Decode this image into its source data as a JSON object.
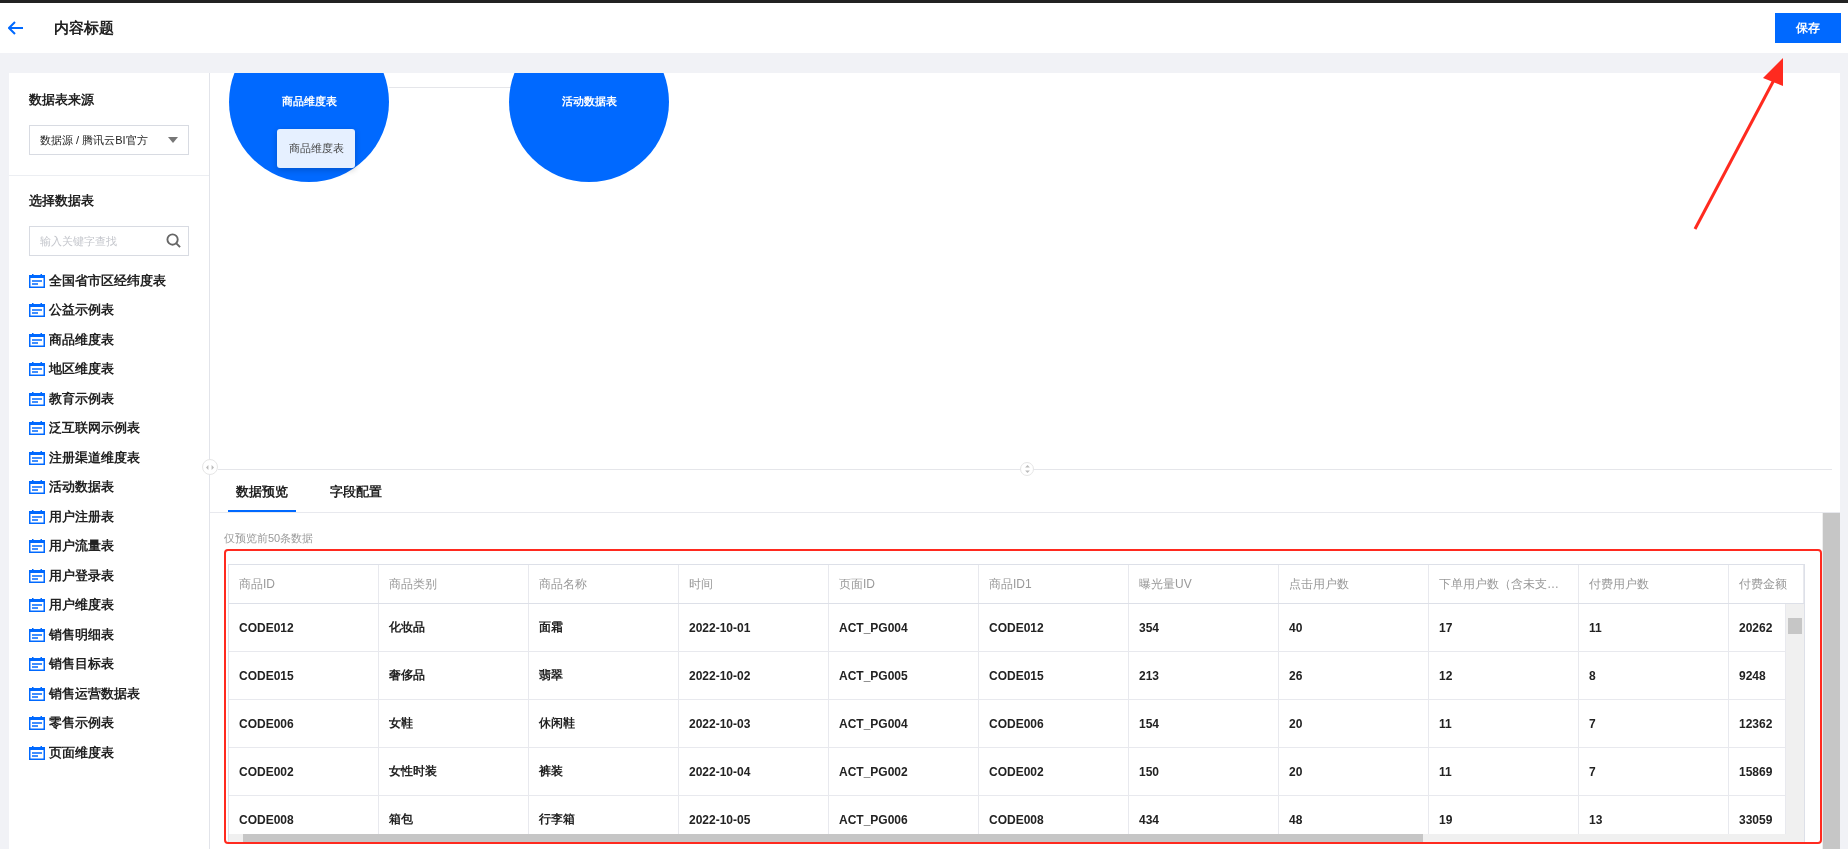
{
  "header": {
    "title": "内容标题",
    "save_button": "保存"
  },
  "sidebar": {
    "source_title": "数据表来源",
    "source_select": "数据源 / 腾讯云BI官方",
    "tables_title": "选择数据表",
    "search": {
      "placeholder": "输入关键字查找"
    },
    "tables": [
      "全国省市区经纬度表",
      "公益示例表",
      "商品维度表",
      "地区维度表",
      "教育示例表",
      "泛互联网示例表",
      "注册渠道维度表",
      "活动数据表",
      "用户注册表",
      "用户流量表",
      "用户登录表",
      "用户维度表",
      "销售明细表",
      "销售目标表",
      "销售运营数据表",
      "零售示例表",
      "页面维度表"
    ]
  },
  "canvas": {
    "nodes": [
      {
        "label": "商品维度表"
      },
      {
        "label": "活动数据表"
      }
    ],
    "hover_card": "商品维度表"
  },
  "tabs": [
    {
      "label": "数据预览",
      "selected": true
    },
    {
      "label": "字段配置",
      "selected": false
    }
  ],
  "preview_note": "仅预览前50条数据",
  "table": {
    "columns": [
      "商品ID",
      "商品类别",
      "商品名称",
      "时间",
      "页面ID",
      "商品ID1",
      "曝光量UV",
      "点击用户数",
      "下单用户数（含未支…",
      "付费用户数",
      "付费金额"
    ],
    "rows": [
      [
        "CODE012",
        "化妆品",
        "面霜",
        "2022-10-01",
        "ACT_PG004",
        "CODE012",
        "354",
        "40",
        "17",
        "11",
        "20262"
      ],
      [
        "CODE015",
        "奢侈品",
        "翡翠",
        "2022-10-02",
        "ACT_PG005",
        "CODE015",
        "213",
        "26",
        "12",
        "8",
        "9248"
      ],
      [
        "CODE006",
        "女鞋",
        "休闲鞋",
        "2022-10-03",
        "ACT_PG004",
        "CODE006",
        "154",
        "20",
        "11",
        "7",
        "12362"
      ],
      [
        "CODE002",
        "女性时装",
        "裤装",
        "2022-10-04",
        "ACT_PG002",
        "CODE002",
        "150",
        "20",
        "11",
        "7",
        "15869"
      ],
      [
        "CODE008",
        "箱包",
        "行李箱",
        "2022-10-05",
        "ACT_PG006",
        "CODE008",
        "434",
        "48",
        "19",
        "13",
        "33059"
      ]
    ]
  }
}
